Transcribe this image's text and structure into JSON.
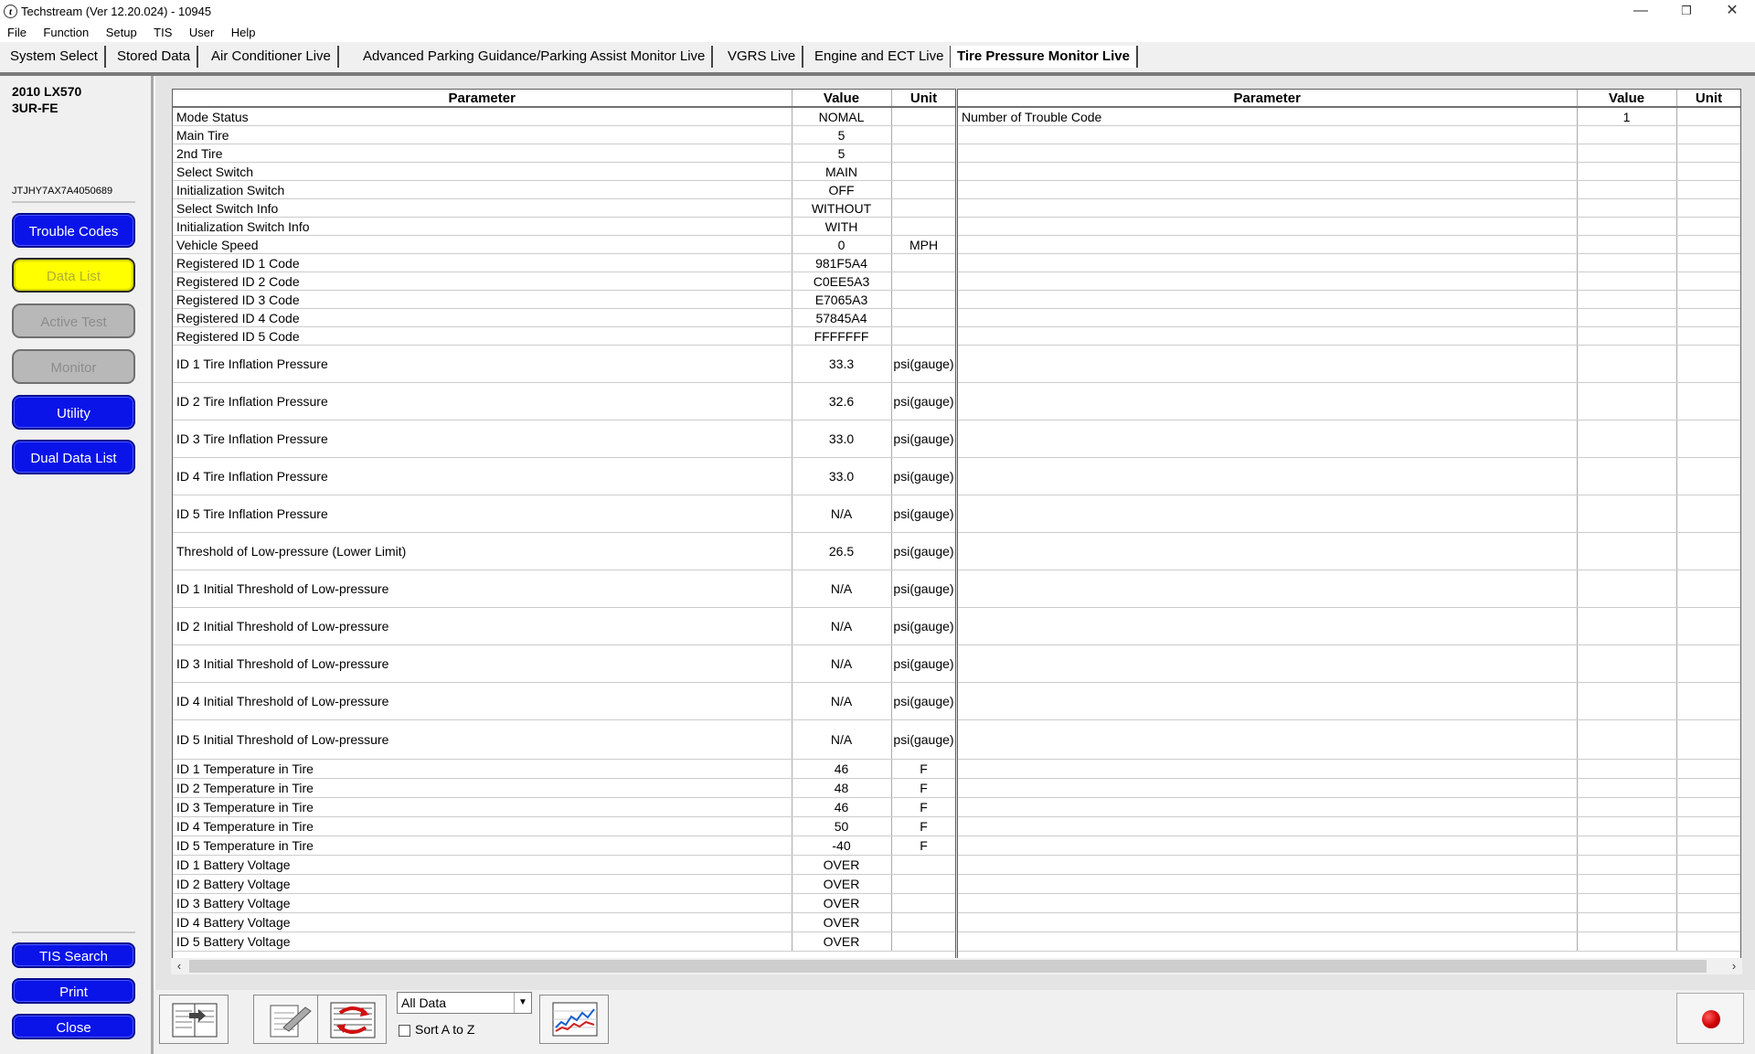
{
  "window": {
    "title": "Techstream (Ver 12.20.024) - 10945",
    "app_icon_glyph": "t",
    "minimize_glyph": "—",
    "restore_glyph": "❐",
    "close_glyph": "✕"
  },
  "menu": [
    "File",
    "Function",
    "Setup",
    "TIS",
    "User",
    "Help"
  ],
  "tabs": [
    "System Select",
    "Stored Data",
    "Air Conditioner Live",
    "Advanced Parking Guidance/Parking Assist Monitor Live",
    "VGRS Live",
    "Engine and ECT Live",
    "Tire Pressure Monitor Live"
  ],
  "active_tab": "Tire Pressure Monitor Live",
  "sidebar": {
    "model": "2010 LX570",
    "engine": "3UR-FE",
    "vin": "JTJHY7AX7A4050689",
    "buttons": {
      "trouble_codes": "Trouble Codes",
      "data_list": "Data List",
      "active_test": "Active Test",
      "monitor": "Monitor",
      "utility": "Utility",
      "dual_data_list": "Dual Data List",
      "tis_search": "TIS Search",
      "print": "Print",
      "close": "Close"
    }
  },
  "left_table": {
    "headers": {
      "parameter": "Parameter",
      "value": "Value",
      "unit": "Unit"
    },
    "rows": [
      {
        "p": "Mode Status",
        "v": "NOMAL",
        "u": ""
      },
      {
        "p": "Main Tire",
        "v": "5",
        "u": ""
      },
      {
        "p": "2nd Tire",
        "v": "5",
        "u": ""
      },
      {
        "p": "Select Switch",
        "v": "MAIN",
        "u": ""
      },
      {
        "p": "Initialization Switch",
        "v": "OFF",
        "u": ""
      },
      {
        "p": "Select Switch Info",
        "v": "WITHOUT",
        "u": ""
      },
      {
        "p": "Initialization Switch Info",
        "v": "WITH",
        "u": ""
      },
      {
        "p": "Vehicle Speed",
        "v": "0",
        "u": "MPH"
      },
      {
        "p": "Registered ID 1 Code",
        "v": "981F5A4",
        "u": ""
      },
      {
        "p": "Registered ID 2 Code",
        "v": "C0EE5A3",
        "u": ""
      },
      {
        "p": "Registered ID 3 Code",
        "v": "E7065A3",
        "u": ""
      },
      {
        "p": "Registered ID 4 Code",
        "v": "57845A4",
        "u": ""
      },
      {
        "p": "Registered ID 5 Code",
        "v": "FFFFFFF",
        "u": ""
      },
      {
        "p": "ID 1 Tire Inflation Pressure",
        "v": "33.3",
        "u": "psi(gauge)"
      },
      {
        "p": "ID 2 Tire Inflation Pressure",
        "v": "32.6",
        "u": "psi(gauge)"
      },
      {
        "p": "ID 3 Tire Inflation Pressure",
        "v": "33.0",
        "u": "psi(gauge)"
      },
      {
        "p": "ID 4 Tire Inflation Pressure",
        "v": "33.0",
        "u": "psi(gauge)"
      },
      {
        "p": "ID 5 Tire Inflation Pressure",
        "v": "N/A",
        "u": "psi(gauge)"
      },
      {
        "p": "Threshold of Low-pressure (Lower Limit)",
        "v": "26.5",
        "u": "psi(gauge)"
      },
      {
        "p": "ID 1 Initial Threshold of Low-pressure",
        "v": "N/A",
        "u": "psi(gauge)"
      },
      {
        "p": "ID 2 Initial Threshold of Low-pressure",
        "v": "N/A",
        "u": "psi(gauge)"
      },
      {
        "p": "ID 3 Initial Threshold of Low-pressure",
        "v": "N/A",
        "u": "psi(gauge)"
      },
      {
        "p": "ID 4 Initial Threshold of Low-pressure",
        "v": "N/A",
        "u": "psi(gauge)"
      },
      {
        "p": "ID 5 Initial Threshold of Low-pressure",
        "v": "N/A",
        "u": "psi(gauge)"
      },
      {
        "p": "ID 1 Temperature in Tire",
        "v": "46",
        "u": "F"
      },
      {
        "p": "ID 2 Temperature in Tire",
        "v": "48",
        "u": "F"
      },
      {
        "p": "ID 3 Temperature in Tire",
        "v": "46",
        "u": "F"
      },
      {
        "p": "ID 4 Temperature in Tire",
        "v": "50",
        "u": "F"
      },
      {
        "p": "ID 5 Temperature in Tire",
        "v": "-40",
        "u": "F"
      },
      {
        "p": "ID 1 Battery Voltage",
        "v": "OVER",
        "u": ""
      },
      {
        "p": "ID 2 Battery Voltage",
        "v": "OVER",
        "u": ""
      },
      {
        "p": "ID 3 Battery Voltage",
        "v": "OVER",
        "u": ""
      },
      {
        "p": "ID 4 Battery Voltage",
        "v": "OVER",
        "u": ""
      },
      {
        "p": "ID 5 Battery Voltage",
        "v": "OVER",
        "u": ""
      }
    ]
  },
  "right_table": {
    "headers": {
      "parameter": "Parameter",
      "value": "Value",
      "unit": "Unit"
    },
    "rows": [
      {
        "p": "Number of Trouble Code",
        "v": "1",
        "u": ""
      }
    ]
  },
  "scrollbar": {
    "left_arrow": "‹",
    "right_arrow": "›"
  },
  "toolbar": {
    "filter_value": "All Data",
    "filter_arrow": "▼",
    "sort_label": "Sort A to Z",
    "sort_checked": false
  }
}
